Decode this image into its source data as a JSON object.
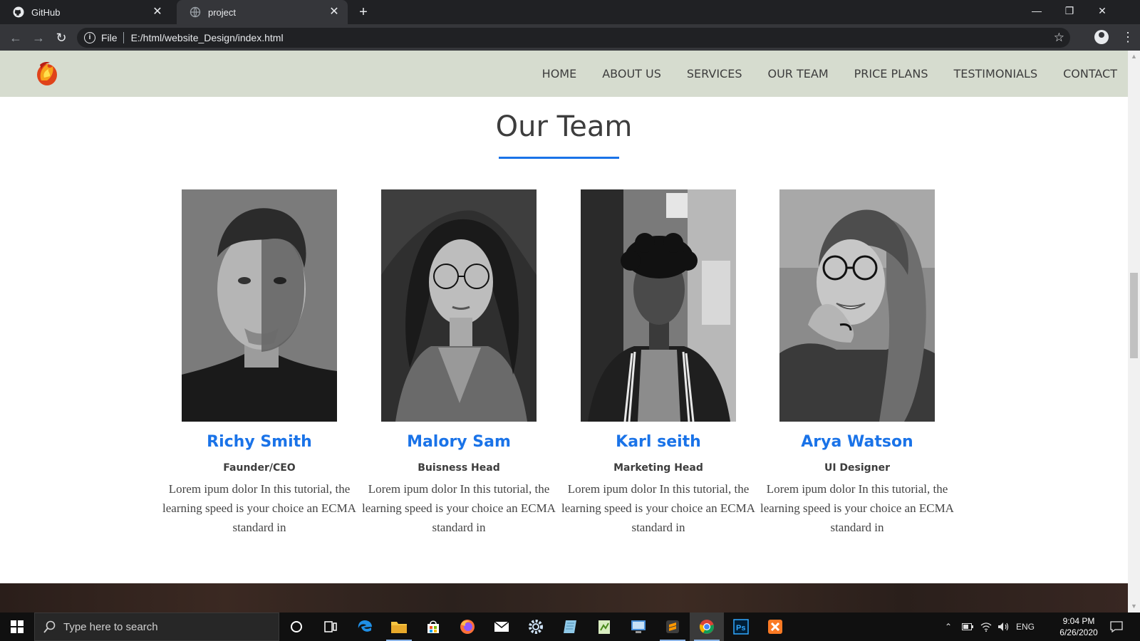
{
  "browser": {
    "tabs": [
      {
        "title": "GitHub",
        "icon": "github-icon",
        "active": false
      },
      {
        "title": "project",
        "icon": "globe-icon",
        "active": true
      }
    ],
    "new_tab_label": "+",
    "address": {
      "scheme_label": "File",
      "url": "E:/html/website_Design/index.html"
    }
  },
  "site": {
    "nav": [
      "HOME",
      "ABOUT US",
      "SERVICES",
      "OUR TEAM",
      "PRICE PLANS",
      "TESTIMONIALS",
      "CONTACT"
    ],
    "section_title": "Our Team",
    "team": [
      {
        "name": "Richy Smith",
        "role": "Faunder/CEO",
        "bio": "Lorem ipum dolor In this tutorial, the learning speed is your choice an ECMA standard in"
      },
      {
        "name": "Malory Sam",
        "role": "Buisness Head",
        "bio": "Lorem ipum dolor In this tutorial, the learning speed is your choice an ECMA standard in"
      },
      {
        "name": "Karl seith",
        "role": "Marketing Head",
        "bio": "Lorem ipum dolor In this tutorial, the learning speed is your choice an ECMA standard in"
      },
      {
        "name": "Arya Watson",
        "role": "UI Designer",
        "bio": "Lorem ipum dolor In this tutorial, the learning speed is your choice an ECMA standard in"
      }
    ],
    "colors": {
      "accent": "#1a73e8",
      "nav_bg": "#d6dccf",
      "text": "#3d3d3d"
    }
  },
  "taskbar": {
    "search_placeholder": "Type here to search",
    "language": "ENG",
    "time": "9:04 PM",
    "date": "6/26/2020"
  }
}
